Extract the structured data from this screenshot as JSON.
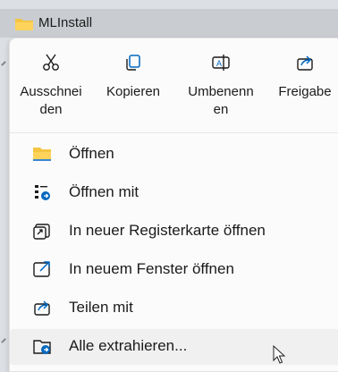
{
  "window": {
    "title": "MLInstall"
  },
  "quick_actions": [
    {
      "label": "Ausschneiden",
      "label_display": "Ausschnei\nden",
      "icon": "scissors-icon"
    },
    {
      "label": "Kopieren",
      "label_display": "Kopieren",
      "icon": "copy-icon"
    },
    {
      "label": "Umbenennen",
      "label_display": "Umbenenn\nen",
      "icon": "rename-icon"
    },
    {
      "label": "Freigabe",
      "label_display": "Freigabe",
      "icon": "share-icon"
    }
  ],
  "menu_items": [
    {
      "label": "Öffnen",
      "icon": "folder-icon"
    },
    {
      "label": "Öffnen mit",
      "icon": "open-with-icon"
    },
    {
      "label": "In neuer Registerkarte öffnen",
      "icon": "new-tab-icon"
    },
    {
      "label": "In neuem Fenster öffnen",
      "icon": "new-window-icon"
    },
    {
      "label": "Teilen mit",
      "icon": "share-icon"
    },
    {
      "label": "Alle extrahieren...",
      "icon": "extract-icon"
    }
  ],
  "colors": {
    "accent": "#0067c0",
    "folder": "#f4c542"
  }
}
